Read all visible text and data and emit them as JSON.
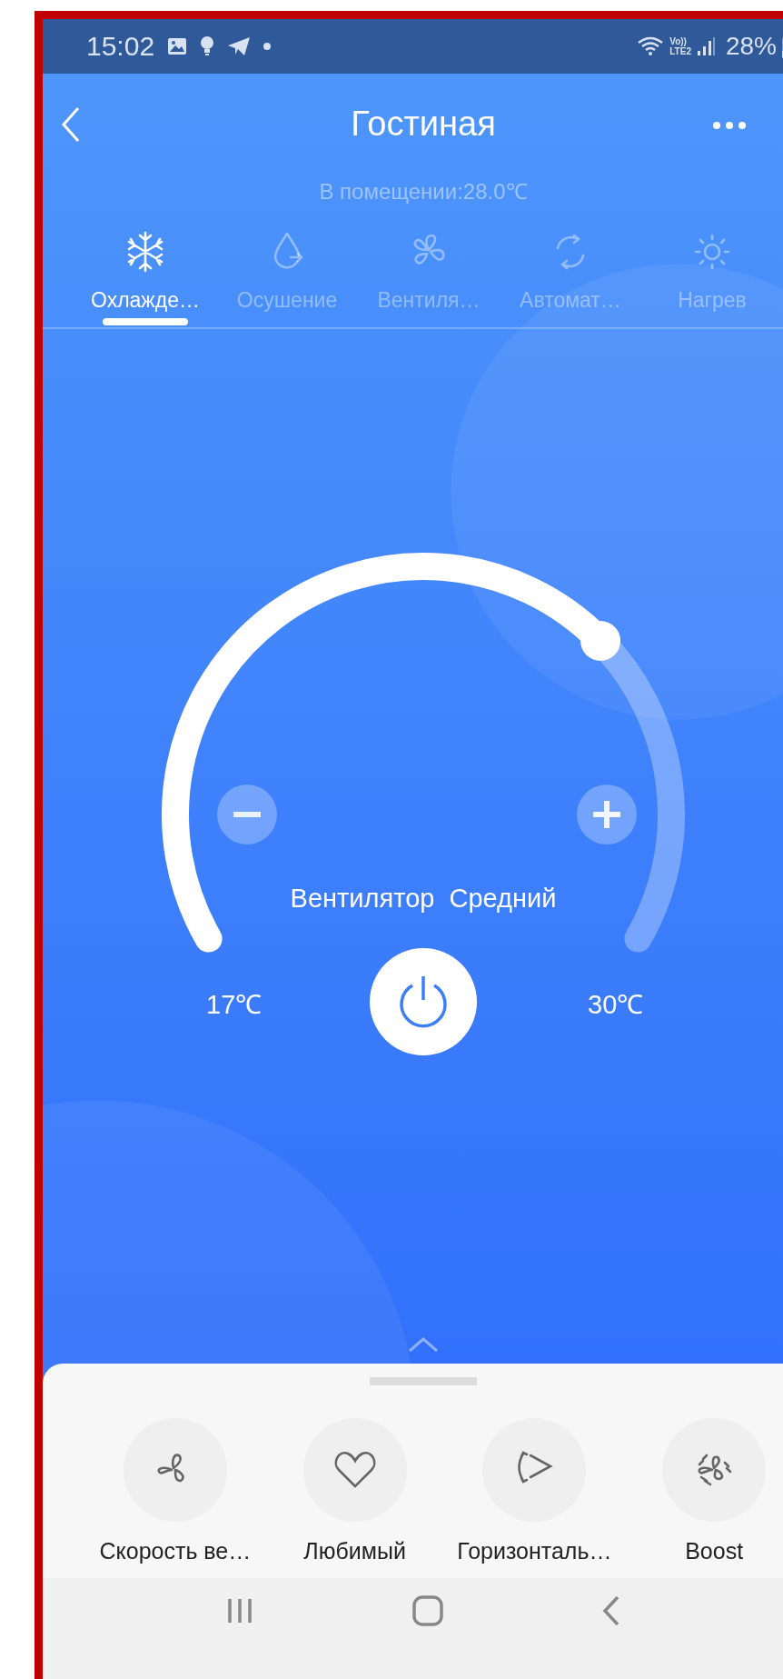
{
  "status_bar": {
    "time": "15:02",
    "volte": "Vo))",
    "lte": "LTE2",
    "battery": "28%"
  },
  "header": {
    "title": "Гостиная",
    "subtitle": "В помещении:28.0℃"
  },
  "modes": [
    {
      "kind": "cool",
      "label": "Охлажде…",
      "selected": true
    },
    {
      "kind": "dry",
      "label": "Осушение",
      "selected": false
    },
    {
      "kind": "fan",
      "label": "Вентиля…",
      "selected": false
    },
    {
      "kind": "auto",
      "label": "Автомат…",
      "selected": false
    },
    {
      "kind": "heat",
      "label": "Нагрев",
      "selected": false
    }
  ],
  "dial": {
    "level": 0.69,
    "mode_text": "Вентилятор  Средний",
    "min": "17℃",
    "max": "30℃"
  },
  "features": [
    {
      "kind": "fan",
      "label": "Скорость ве…"
    },
    {
      "kind": "heart",
      "label": "Любимый"
    },
    {
      "kind": "swing",
      "label": "Горизонталь…"
    },
    {
      "kind": "boost",
      "label": "Boost"
    }
  ]
}
